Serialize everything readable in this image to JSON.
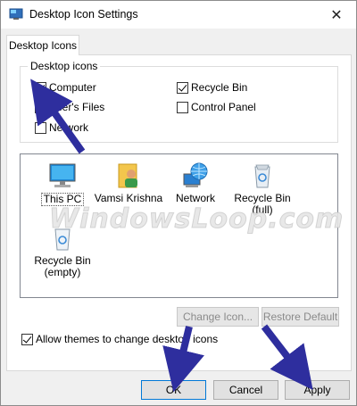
{
  "window": {
    "title": "Desktop Icon Settings",
    "close_glyph": "✕"
  },
  "tab": {
    "label": "Desktop Icons"
  },
  "desktop_icons_group": {
    "legend": "Desktop icons",
    "checkboxes": [
      {
        "label": "Computer",
        "checked": true
      },
      {
        "label": "Recycle Bin",
        "checked": true
      },
      {
        "label": "User's Files",
        "checked": false
      },
      {
        "label": "Control Panel",
        "checked": false
      },
      {
        "label": "Network",
        "checked": false
      }
    ]
  },
  "icon_list": {
    "items": [
      {
        "label": "This PC",
        "icon": "computer-monitor-icon",
        "selected": true
      },
      {
        "label": "Vamsi Krishna",
        "icon": "user-folder-icon",
        "selected": false
      },
      {
        "label": "Network",
        "icon": "network-globe-icon",
        "selected": false
      },
      {
        "label": "Recycle Bin\n(full)",
        "icon": "recycle-bin-full-icon",
        "selected": false
      },
      {
        "label": "Recycle Bin\n(empty)",
        "icon": "recycle-bin-empty-icon",
        "selected": false
      }
    ]
  },
  "buttons": {
    "change_icon": "Change Icon...",
    "restore_default": "Restore Default",
    "ok": "OK",
    "cancel": "Cancel",
    "apply": "Apply"
  },
  "allow_themes": {
    "label": "Allow themes to change desktop icons",
    "checked": true
  },
  "watermark": {
    "text": "WindowsLoop.com"
  },
  "colors": {
    "annotation_arrow": "#2e2e9e",
    "focus_border": "#0078d7"
  }
}
